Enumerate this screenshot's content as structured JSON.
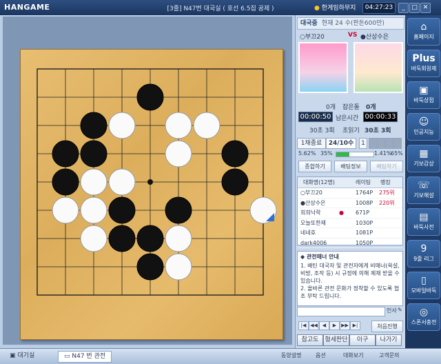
{
  "app": {
    "logo": "HANGAME",
    "window_title": "[3줄] N47번 대국실 ( 호선 6.5집 공제 )",
    "user_badge": "한게임하무지",
    "clock": "04:27:23"
  },
  "game": {
    "status": "대국중",
    "move_info": "현재 24 수(판돈600만)",
    "player_white": "부끄20",
    "vs": "VS",
    "player_black": "산상수은",
    "captured_white": "0개",
    "captured_label": "잡은돌",
    "captured_black": "0개",
    "time_white": "00:00:50",
    "time_label": "남은시간",
    "time_black": "00:00:33",
    "byoyomi_white": "30초 3회",
    "byoyomi_label": "초읽기",
    "byoyomi_black": "30초 3회"
  },
  "tabs": {
    "tab1": "1채종료",
    "tab2": "24/10수",
    "tab3": "1"
  },
  "progress": {
    "left": "5.62%",
    "left_pct": "35%",
    "right": "1.41%",
    "right_pct": "65%"
  },
  "buttons": {
    "b1": "종합하기",
    "b2": "배팅정보",
    "b3": "배팅하기"
  },
  "list": {
    "headers": [
      "대화명(12명)",
      "레이팅",
      "랭킹"
    ],
    "rows": [
      {
        "name": "○부끄20",
        "rating": "1764P",
        "rank": "275위"
      },
      {
        "name": "●산상수은",
        "rating": "1008P",
        "rank": "220위"
      },
      {
        "name": "희희낙락",
        "rating": "671P",
        "rank": ""
      },
      {
        "name": "오늘또한재",
        "rating": "1030P",
        "rank": ""
      },
      {
        "name": "네네호",
        "rating": "1081P",
        "rank": ""
      },
      {
        "name": "dark4006",
        "rating": "1050P",
        "rank": ""
      }
    ]
  },
  "chat": {
    "header": "◆ 관전매너 안내",
    "lines": [
      "1. 배틴 대국자 및 관전자에게 비매너(욕설, 비방, 조작 등) 시 규정에 의해 제재 받을 수 있습니다.",
      "2. 올바른 관전 문화가 정착할 수 있도록 협조 부탁 드립니다."
    ],
    "input_label": "인사"
  },
  "nav": {
    "replay": "처음진행"
  },
  "bottom": {
    "b1": "참고도",
    "b2": "형세판단",
    "b3": "이구",
    "b4": "나가기"
  },
  "sidebar": [
    {
      "label": "홈페이지",
      "icon": "home-icon"
    },
    {
      "label": "바둑회원제",
      "icon": "plus-icon"
    },
    {
      "label": "바둑상점",
      "icon": "shop-icon"
    },
    {
      "label": "인공지능",
      "icon": "ai-icon"
    },
    {
      "label": "기보감상",
      "icon": "board-icon"
    },
    {
      "label": "기보해설",
      "icon": "comment-icon"
    },
    {
      "label": "바둑사전",
      "icon": "book-icon"
    },
    {
      "label": "9줄 리그",
      "icon": "league-icon"
    },
    {
      "label": "모바일바둑",
      "icon": "mobile-icon"
    },
    {
      "label": "스폰서충전",
      "icon": "sponsor-icon"
    }
  ],
  "footer": {
    "tab1": "대기실",
    "tab2": "N47 번 관전",
    "items": [
      "동양설명",
      "옵션",
      "대화보기",
      "고객문의"
    ]
  },
  "board": {
    "size": 9,
    "black": [
      [
        4,
        1
      ],
      [
        2,
        2
      ],
      [
        1,
        3
      ],
      [
        2,
        3
      ],
      [
        1,
        4
      ],
      [
        7,
        3
      ],
      [
        7,
        4
      ],
      [
        3,
        5
      ],
      [
        5,
        5
      ],
      [
        3,
        6
      ],
      [
        4,
        6
      ],
      [
        4,
        7
      ]
    ],
    "white": [
      [
        3,
        2
      ],
      [
        5,
        2
      ],
      [
        6,
        2
      ],
      [
        5,
        3
      ],
      [
        2,
        4
      ],
      [
        3,
        4
      ],
      [
        2,
        5
      ],
      [
        2,
        6
      ],
      [
        5,
        6
      ],
      [
        5,
        7
      ],
      [
        8,
        5
      ],
      [
        1,
        5
      ]
    ],
    "star": [
      [
        4,
        4
      ]
    ]
  }
}
